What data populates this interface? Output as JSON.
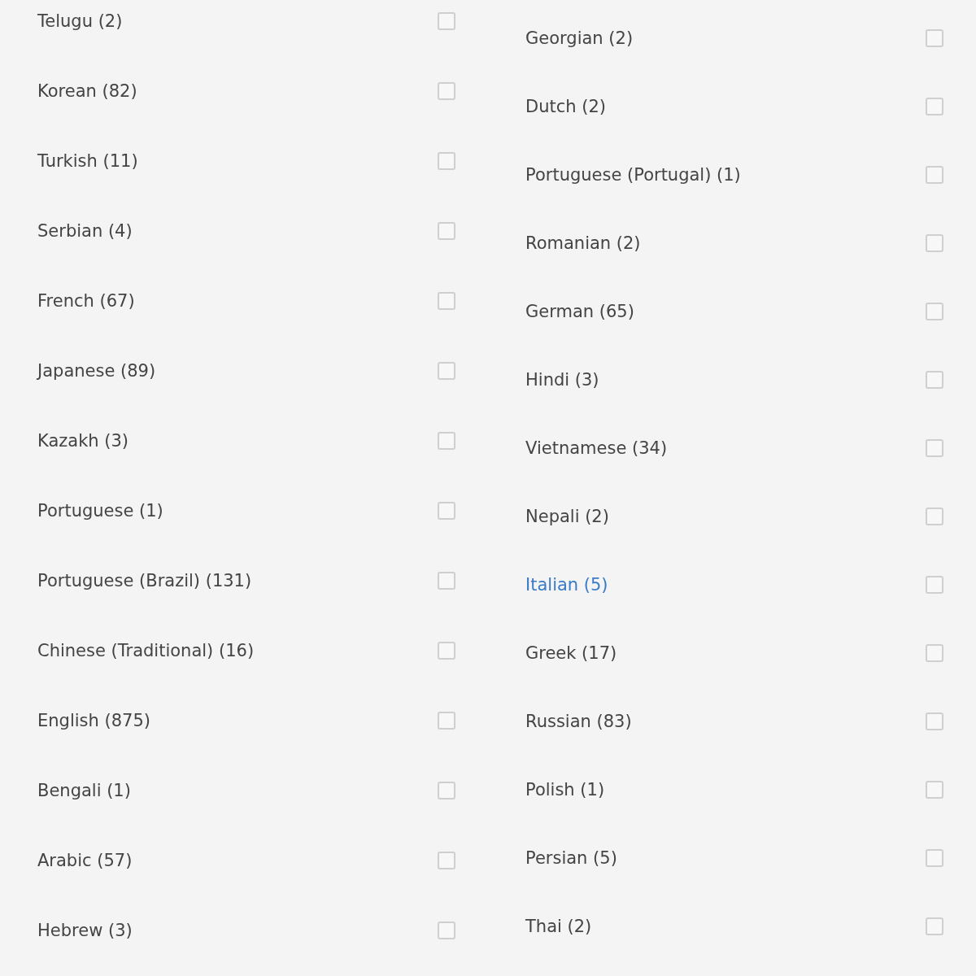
{
  "columns": [
    {
      "items": [
        {
          "label": "Telugu (2)",
          "highlighted": false,
          "checked": false
        },
        {
          "label": "Korean (82)",
          "highlighted": false,
          "checked": false
        },
        {
          "label": "Turkish (11)",
          "highlighted": false,
          "checked": false
        },
        {
          "label": "Serbian (4)",
          "highlighted": false,
          "checked": false
        },
        {
          "label": "French (67)",
          "highlighted": false,
          "checked": false
        },
        {
          "label": "Japanese (89)",
          "highlighted": false,
          "checked": false
        },
        {
          "label": "Kazakh (3)",
          "highlighted": false,
          "checked": false
        },
        {
          "label": "Portuguese (1)",
          "highlighted": false,
          "checked": false
        },
        {
          "label": "Portuguese (Brazil) (131)",
          "highlighted": false,
          "checked": false
        },
        {
          "label": "Chinese (Traditional) (16)",
          "highlighted": false,
          "checked": false
        },
        {
          "label": "English (875)",
          "highlighted": false,
          "checked": false
        },
        {
          "label": "Bengali (1)",
          "highlighted": false,
          "checked": false
        },
        {
          "label": "Arabic (57)",
          "highlighted": false,
          "checked": false
        },
        {
          "label": "Hebrew (3)",
          "highlighted": false,
          "checked": false
        }
      ]
    },
    {
      "items": [
        {
          "label": "Georgian (2)",
          "highlighted": false,
          "checked": false
        },
        {
          "label": "Dutch (2)",
          "highlighted": false,
          "checked": false
        },
        {
          "label": "Portuguese (Portugal) (1)",
          "highlighted": false,
          "checked": false
        },
        {
          "label": "Romanian (2)",
          "highlighted": false,
          "checked": false
        },
        {
          "label": "German (65)",
          "highlighted": false,
          "checked": false
        },
        {
          "label": "Hindi (3)",
          "highlighted": false,
          "checked": false
        },
        {
          "label": "Vietnamese (34)",
          "highlighted": false,
          "checked": false
        },
        {
          "label": "Nepali (2)",
          "highlighted": false,
          "checked": false
        },
        {
          "label": "Italian (5)",
          "highlighted": true,
          "checked": false
        },
        {
          "label": "Greek (17)",
          "highlighted": false,
          "checked": false
        },
        {
          "label": "Russian (83)",
          "highlighted": false,
          "checked": false
        },
        {
          "label": "Polish (1)",
          "highlighted": false,
          "checked": false
        },
        {
          "label": "Persian (5)",
          "highlighted": false,
          "checked": false
        },
        {
          "label": "Thai (2)",
          "highlighted": false,
          "checked": false
        }
      ]
    }
  ]
}
